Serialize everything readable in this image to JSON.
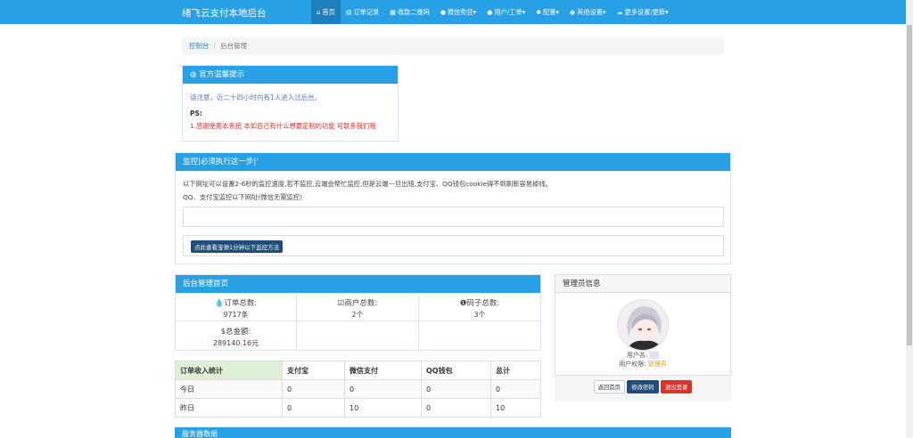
{
  "brand": "绪飞云支付本地后台",
  "nav": [
    {
      "icon": "⌂",
      "label": "首页"
    },
    {
      "icon": "▤",
      "label": "订单记录"
    },
    {
      "icon": "▦",
      "label": "收款二维码"
    },
    {
      "icon": "●",
      "label": "微信免挂▾"
    },
    {
      "icon": "●",
      "label": "用户/工单▾"
    },
    {
      "icon": "✱",
      "label": "配置▾"
    },
    {
      "icon": "◉",
      "label": "其他设置▾"
    },
    {
      "icon": "☁",
      "label": "更多设置/更新▾"
    }
  ],
  "breadcrumb": {
    "home": "控制台",
    "sep": "/",
    "current": "后台管理"
  },
  "notice": {
    "title": "官方温馨提示",
    "line1": "请注意，近二十四小时内有1人进入过后台。",
    "ps": "PS:",
    "line2": "1.感谢使用本系统 本如自己有什么想要定制的功能 可联系我们哦"
  },
  "monitor": {
    "title": "监控|必须执行这一步|'",
    "line1": "以下网址可以设置2-6秒的监控速度,若不监控,云端会帮忙监控,但是云端一旦出错,支付宝、QQ钱包cookie得不到刷新容易掉线。",
    "line2": "QQ、支付宝监控以下网址(微信无需监控)",
    "url_value": "",
    "button": "点此查看宝顿1分钟以下监控方法"
  },
  "dashboard": {
    "title": "后台管理首页",
    "stats": [
      {
        "icon": "💧",
        "label": "订单总数:",
        "value": "9717条"
      },
      {
        "icon": "☑",
        "label": "商户总数:",
        "value": "2个"
      },
      {
        "icon": "❶",
        "label": "码子总数:",
        "value": "3个"
      },
      {
        "icon": "$",
        "label": "总金额:",
        "value": "289140.16元"
      }
    ]
  },
  "income_table": {
    "headers": [
      "订单收入统计",
      "支付宝",
      "微信支付",
      "QQ钱包",
      "总计"
    ],
    "rows": [
      [
        "今日",
        "0",
        "0",
        "0",
        "0"
      ],
      [
        "昨日",
        "0",
        "10",
        "0",
        "10"
      ]
    ]
  },
  "admin": {
    "title": "管理员信息",
    "username_label": "用户名:",
    "username": "▒▒",
    "role_label": "用户权限:",
    "role": "管理员",
    "buttons": [
      "返回首页",
      "修改密码",
      "退出登录"
    ]
  },
  "next_panel_title": "服务器数据"
}
